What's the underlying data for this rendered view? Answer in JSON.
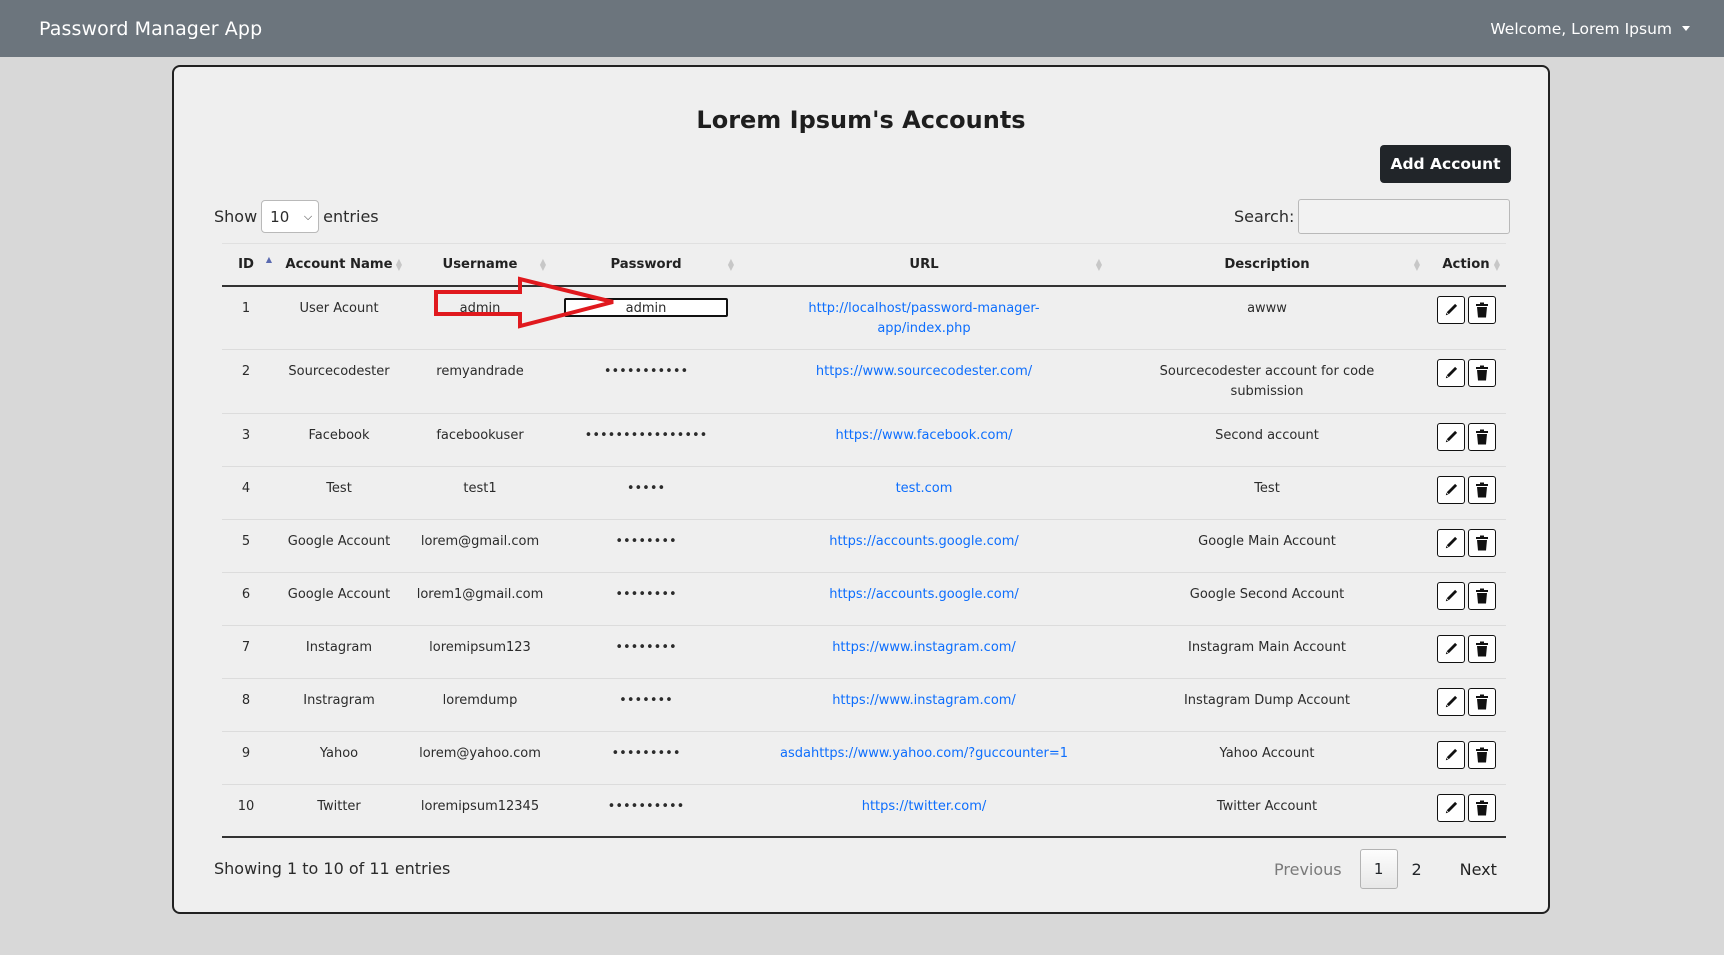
{
  "navbar": {
    "brand": "Password Manager App",
    "welcome": "Welcome, Lorem Ipsum"
  },
  "page": {
    "title": "Lorem Ipsum's Accounts",
    "add_button": "Add Account"
  },
  "length_control": {
    "show_label": "Show",
    "value": "10",
    "entries_label": "entries"
  },
  "search": {
    "label": "Search:",
    "value": ""
  },
  "table": {
    "columns": [
      "ID",
      "Account Name",
      "Username",
      "Password",
      "URL",
      "Description",
      "Action"
    ],
    "sorted_column": "ID",
    "rows": [
      {
        "id": "1",
        "account": "User Acount",
        "username": "admin",
        "password": "admin",
        "url": "http://localhost/password-manager-app/index.php",
        "description": "awww"
      },
      {
        "id": "2",
        "account": "Sourcecodester",
        "username": "remyandrade",
        "password": "•••••••••••",
        "url": "https://www.sourcecodester.com/",
        "description": "Sourcecodester account for code submission"
      },
      {
        "id": "3",
        "account": "Facebook",
        "username": "facebookuser",
        "password": "••••••••••••••••",
        "url": "https://www.facebook.com/",
        "description": "Second account"
      },
      {
        "id": "4",
        "account": "Test",
        "username": "test1",
        "password": "•••••",
        "url": "test.com",
        "description": "Test"
      },
      {
        "id": "5",
        "account": "Google Account",
        "username": "lorem@gmail.com",
        "password": "••••••••",
        "url": "https://accounts.google.com/",
        "description": "Google Main Account"
      },
      {
        "id": "6",
        "account": "Google Account",
        "username": "lorem1@gmail.com",
        "password": "••••••••",
        "url": "https://accounts.google.com/",
        "description": "Google Second Account"
      },
      {
        "id": "7",
        "account": "Instagram",
        "username": "loremipsum123",
        "password": "••••••••",
        "url": "https://www.instagram.com/",
        "description": "Instagram Main Account"
      },
      {
        "id": "8",
        "account": "Instragram",
        "username": "loremdump",
        "password": "•••••••",
        "url": "https://www.instagram.com/",
        "description": "Instagram Dump Account"
      },
      {
        "id": "9",
        "account": "Yahoo",
        "username": "lorem@yahoo.com",
        "password": "•••••••••",
        "url": "asdahttps://www.yahoo.com/?guccounter=1",
        "description": "Yahoo Account"
      },
      {
        "id": "10",
        "account": "Twitter",
        "username": "loremipsum12345",
        "password": "••••••••••",
        "url": "https://twitter.com/",
        "description": "Twitter Account"
      }
    ]
  },
  "footer": {
    "info": "Showing 1 to 10 of 11 entries",
    "previous": "Previous",
    "pages": [
      "1",
      "2"
    ],
    "current_page": "1",
    "next": "Next"
  },
  "icons": {
    "edit": "pencil-icon",
    "delete": "trash-icon",
    "annotation": "red-arrow"
  },
  "colors": {
    "navbar_bg": "#6c757d",
    "link": "#0d6efd",
    "button_dark": "#212529",
    "annotation": "#e0191e"
  }
}
